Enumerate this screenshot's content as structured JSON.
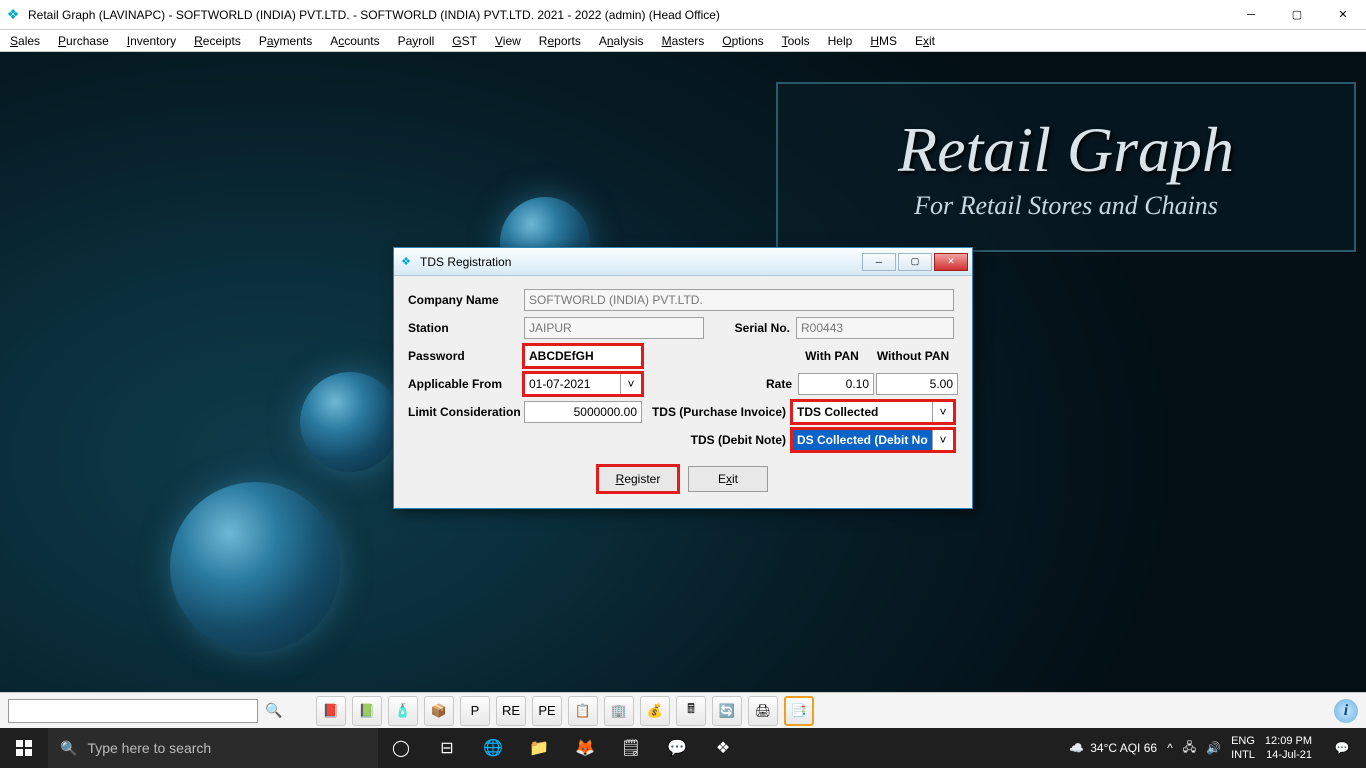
{
  "window": {
    "title": "Retail Graph (LAVINAPC) - SOFTWORLD (INDIA) PVT.LTD. - SOFTWORLD (INDIA) PVT.LTD.  2021 - 2022 (admin) (Head Office)"
  },
  "menus": {
    "sales": "Sales",
    "purchase": "Purchase",
    "inventory": "Inventory",
    "receipts": "Receipts",
    "payments": "Payments",
    "accounts": "Accounts",
    "payroll": "Payroll",
    "gst": "GST",
    "view": "View",
    "reports": "Reports",
    "analysis": "Analysis",
    "masters": "Masters",
    "options": "Options",
    "tools": "Tools",
    "help": "Help",
    "hms": "HMS",
    "exit": "Exit"
  },
  "branding": {
    "line1": "Retail Graph",
    "line2": "For Retail Stores and Chains"
  },
  "dialog": {
    "title": "TDS Registration",
    "labels": {
      "company": "Company Name",
      "station": "Station",
      "serial": "Serial No.",
      "password": "Password",
      "applicable": "Applicable From",
      "withpan": "With PAN",
      "withoutpan": "Without PAN",
      "rate": "Rate",
      "limit": "Limit Consideration",
      "tds_pi": "TDS (Purchase Invoice)",
      "tds_dn": "TDS (Debit Note)"
    },
    "values": {
      "company": "SOFTWORLD (INDIA) PVT.LTD.",
      "station": "JAIPUR",
      "serial": "R00443",
      "password": "ABCDEfGH",
      "applicable": "01-07-2021",
      "rate_with": "0.10",
      "rate_without": "5.00",
      "limit": "5000000.00",
      "tds_pi": "TDS Collected",
      "tds_dn": "DS Collected (Debit Note)"
    },
    "buttons": {
      "register": "Register",
      "exit": "Exit"
    }
  },
  "taskbar": {
    "search_placeholder": "Type here to search",
    "weather": "34°C  AQI 66",
    "lang1": "ENG",
    "lang2": "INTL",
    "time": "12:09 PM",
    "date": "14-Jul-21"
  }
}
